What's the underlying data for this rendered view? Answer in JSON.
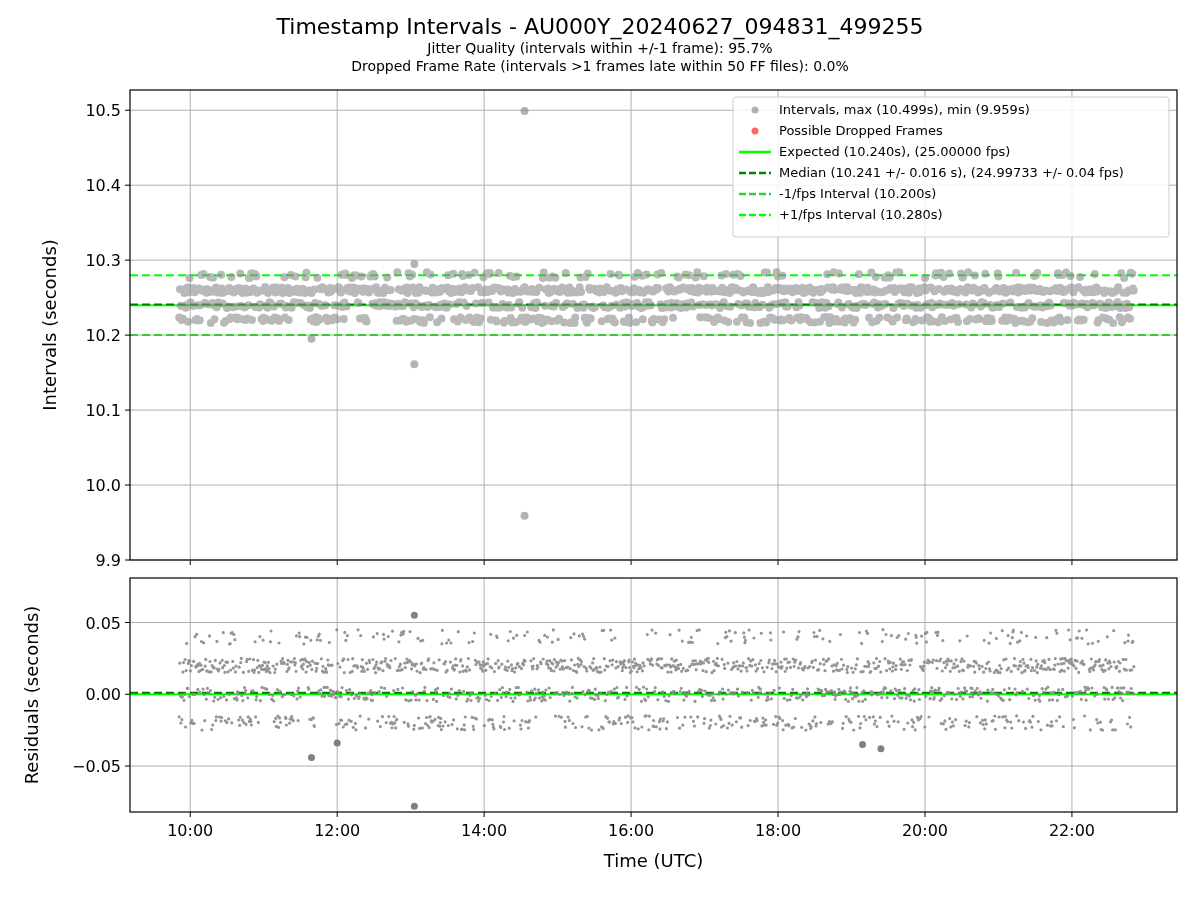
{
  "title": "Timestamp Intervals - AU000Y_20240627_094831_499255",
  "subtitles": [
    "Jitter Quality (intervals within +/-1 frame): 95.7%",
    "Dropped Frame Rate (intervals >1 frames late within 50 FF files): 0.0%"
  ],
  "intervals_plot": {
    "chart_data": {
      "type": "scatter",
      "ylabel": "Intervals (seconds)",
      "grid": true,
      "xlim": [
        9.18,
        23.43
      ],
      "ylim": [
        9.9,
        10.527
      ],
      "yticks": [
        {
          "value": 9.9,
          "label": "9.9"
        },
        {
          "value": 10.0,
          "label": "10.0"
        },
        {
          "value": 10.1,
          "label": "10.1"
        },
        {
          "value": 10.2,
          "label": "10.2"
        },
        {
          "value": 10.3,
          "label": "10.3"
        },
        {
          "value": 10.4,
          "label": "10.4"
        },
        {
          "value": 10.5,
          "label": "10.5"
        }
      ],
      "series": [
        {
          "name": "Intervals, max (10.499s), min (9.959s)",
          "color": "#808080",
          "x": [
            14.55,
            14.55,
            13.05,
            13.05,
            11.65
          ],
          "values": [
            10.499,
            9.959,
            10.161,
            10.295,
            10.195
          ]
        },
        {
          "name": "Possible Dropped Frames",
          "color": "#ff0000"
        }
      ],
      "legend": true,
      "ref_lines": [
        {
          "axis": "y",
          "value": 10.24,
          "label": "Expected (10.240s), (25.00000 fps)",
          "color": "#00ff00"
        },
        {
          "axis": "y",
          "value": 10.241,
          "label": "Median (10.241 +/- 0.016 s), (24.99733 +/- 0.04 fps)",
          "color": "#008000"
        },
        {
          "axis": "y",
          "value": 10.2,
          "label": "-1/fps Interval (10.200s)",
          "color": "#32cd32"
        },
        {
          "axis": "y",
          "value": 10.28,
          "label": "+1/fps Interval (10.280s)",
          "color": "#00ff00"
        }
      ]
    }
  },
  "residuals_plot": {
    "chart_data": {
      "type": "scatter",
      "xlabel": "Time (UTC)",
      "ylabel": "Residuals (seconds)",
      "grid": true,
      "xlim": [
        9.18,
        23.43
      ],
      "ylim": [
        -0.082,
        0.081
      ],
      "xticks": [
        {
          "value": 10,
          "label": "10:00"
        },
        {
          "value": 12,
          "label": "12:00"
        },
        {
          "value": 14,
          "label": "14:00"
        },
        {
          "value": 16,
          "label": "16:00"
        },
        {
          "value": 18,
          "label": "18:00"
        },
        {
          "value": 20,
          "label": "20:00"
        },
        {
          "value": 22,
          "label": "22:00"
        }
      ],
      "yticks": [
        {
          "value": -0.05,
          "label": "−0.05"
        },
        {
          "value": 0,
          "label": "0.00"
        },
        {
          "value": 0.05,
          "label": "0.05"
        }
      ],
      "series": [
        {
          "color": "#808080",
          "x": [
            13.05,
            13.05,
            11.65,
            12.0,
            19.15,
            19.4
          ],
          "values": [
            0.055,
            -0.078,
            -0.044,
            -0.034,
            -0.035,
            -0.038
          ]
        }
      ],
      "ref_lines": [
        {
          "axis": "y",
          "value": 0,
          "color": "#00ff00"
        },
        {
          "axis": "y",
          "value": 0.001,
          "color": "#008000"
        }
      ]
    }
  }
}
